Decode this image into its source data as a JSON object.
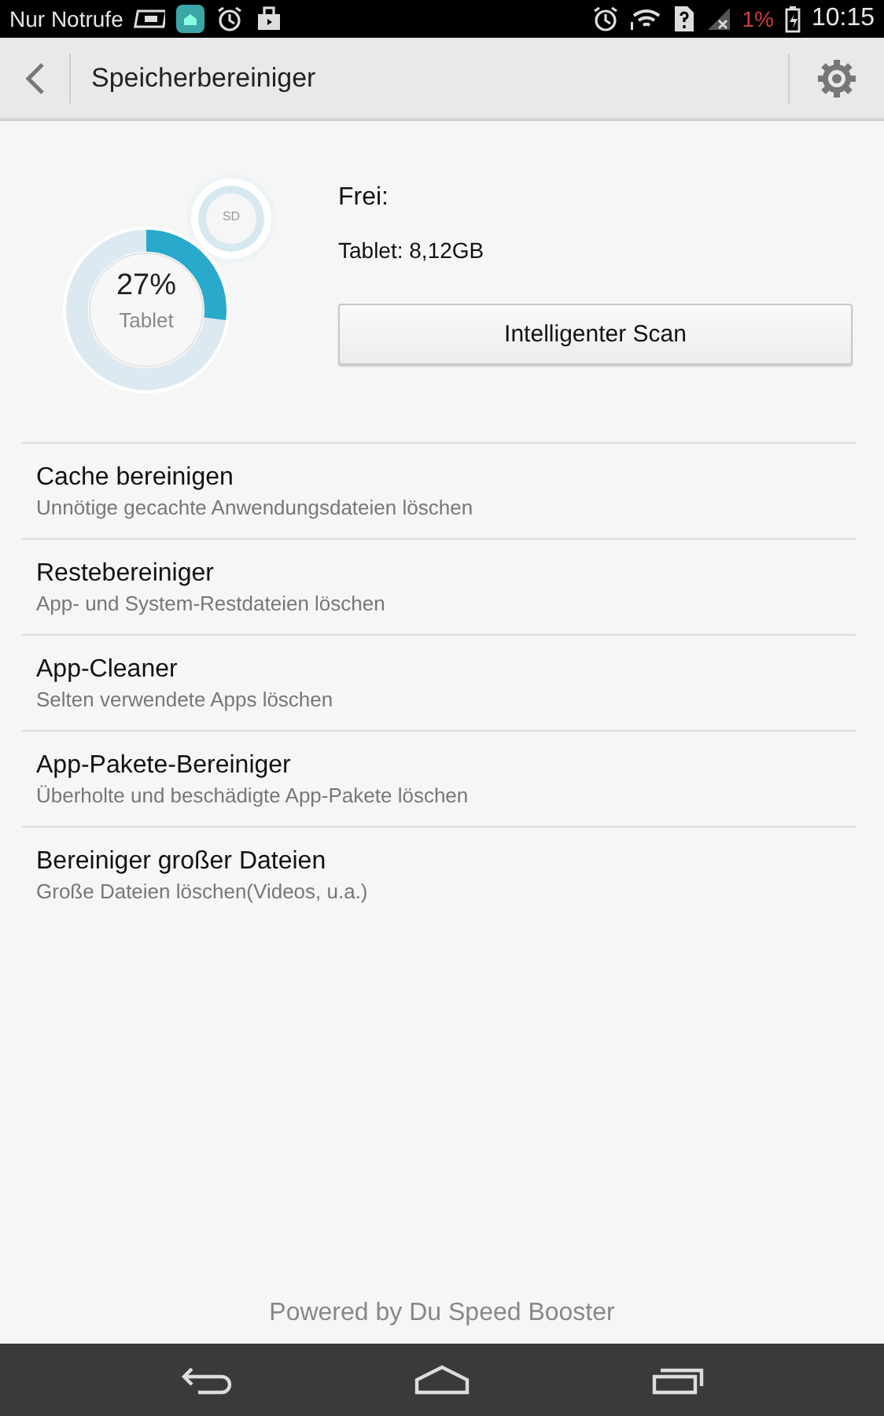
{
  "status_bar": {
    "carrier": "Nur Notrufe",
    "battery_text": "1%",
    "time": "10:15"
  },
  "app_bar": {
    "title": "Speicherbereiniger"
  },
  "storage": {
    "gauge": {
      "percent": "27%",
      "label": "Tablet",
      "level": 0.27,
      "sd_label": "SD"
    },
    "free_label": "Frei:",
    "free_value": "Tablet: 8,12GB",
    "scan_button": "Intelligenter Scan"
  },
  "items": [
    {
      "title": "Cache bereinigen",
      "subtitle": "Unnötige gecachte Anwendungsdateien löschen"
    },
    {
      "title": "Restebereiniger",
      "subtitle": "App- und System-Restdateien löschen"
    },
    {
      "title": "App-Cleaner",
      "subtitle": "Selten verwendete Apps löschen"
    },
    {
      "title": "App-Pakete-Bereiniger",
      "subtitle": "Überholte und beschädigte App-Pakete löschen"
    },
    {
      "title": "Bereiniger großer Dateien",
      "subtitle": "Große Dateien löschen(Videos, u.a.)"
    }
  ],
  "footer": "Powered by Du Speed Booster"
}
